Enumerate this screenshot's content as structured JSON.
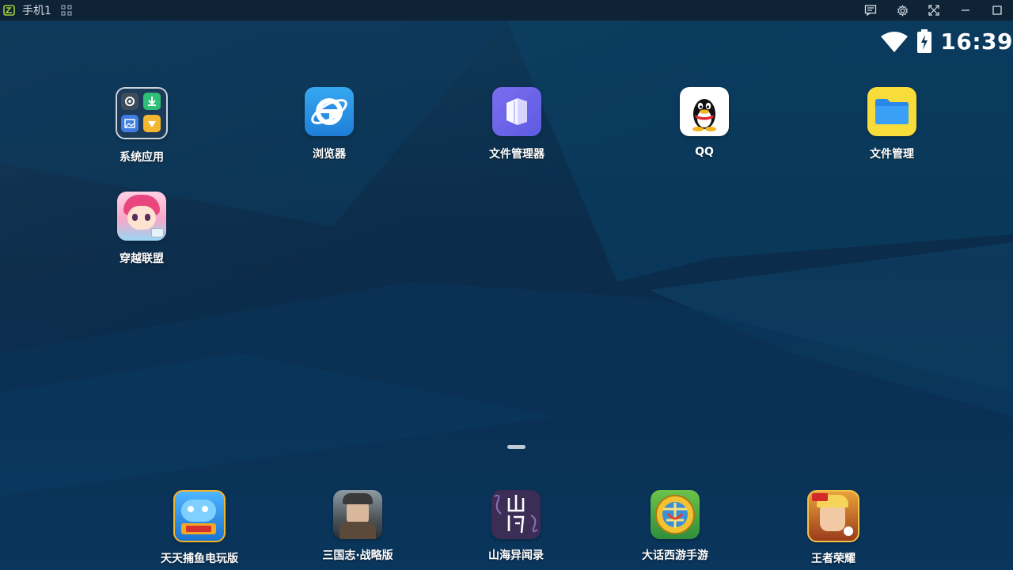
{
  "window": {
    "title": "手机1",
    "app_icon": "emulator-logo-icon",
    "grid_icon": "qr-grid-icon",
    "buttons": [
      "message-icon",
      "settings-icon",
      "fullscreen-icon",
      "minimize-icon",
      "maximize-icon"
    ]
  },
  "status_bar": {
    "time": "16:39",
    "wifi_icon": "wifi-icon",
    "battery_icon": "battery-charging-icon"
  },
  "home": {
    "apps": [
      {
        "label": "系统应用",
        "icon": "system-apps-folder-icon"
      },
      {
        "label": "浏览器",
        "icon": "browser-icon"
      },
      {
        "label": "文件管理器",
        "icon": "file-manager-purple-icon"
      },
      {
        "label": "QQ",
        "icon": "qq-penguin-icon"
      },
      {
        "label": "文件管理",
        "icon": "folder-icon"
      },
      {
        "label": "穿越联盟",
        "icon": "game-girl-icon"
      }
    ]
  },
  "dock": {
    "apps": [
      {
        "label": "天天捕鱼电玩版",
        "icon": "fishing-game-icon"
      },
      {
        "label": "三国志·战略版",
        "icon": "three-kingdoms-icon"
      },
      {
        "label": "山海异闻录",
        "icon": "shanhai-icon"
      },
      {
        "label": "大话西游手游",
        "icon": "westward-journey-icon"
      },
      {
        "label": "王者荣耀",
        "icon": "honor-of-kings-icon"
      }
    ]
  },
  "colors": {
    "titlebar_bg": "#0f2336",
    "desktop_bg": "#0a2f4f",
    "accent_green": "#8bc34a"
  }
}
